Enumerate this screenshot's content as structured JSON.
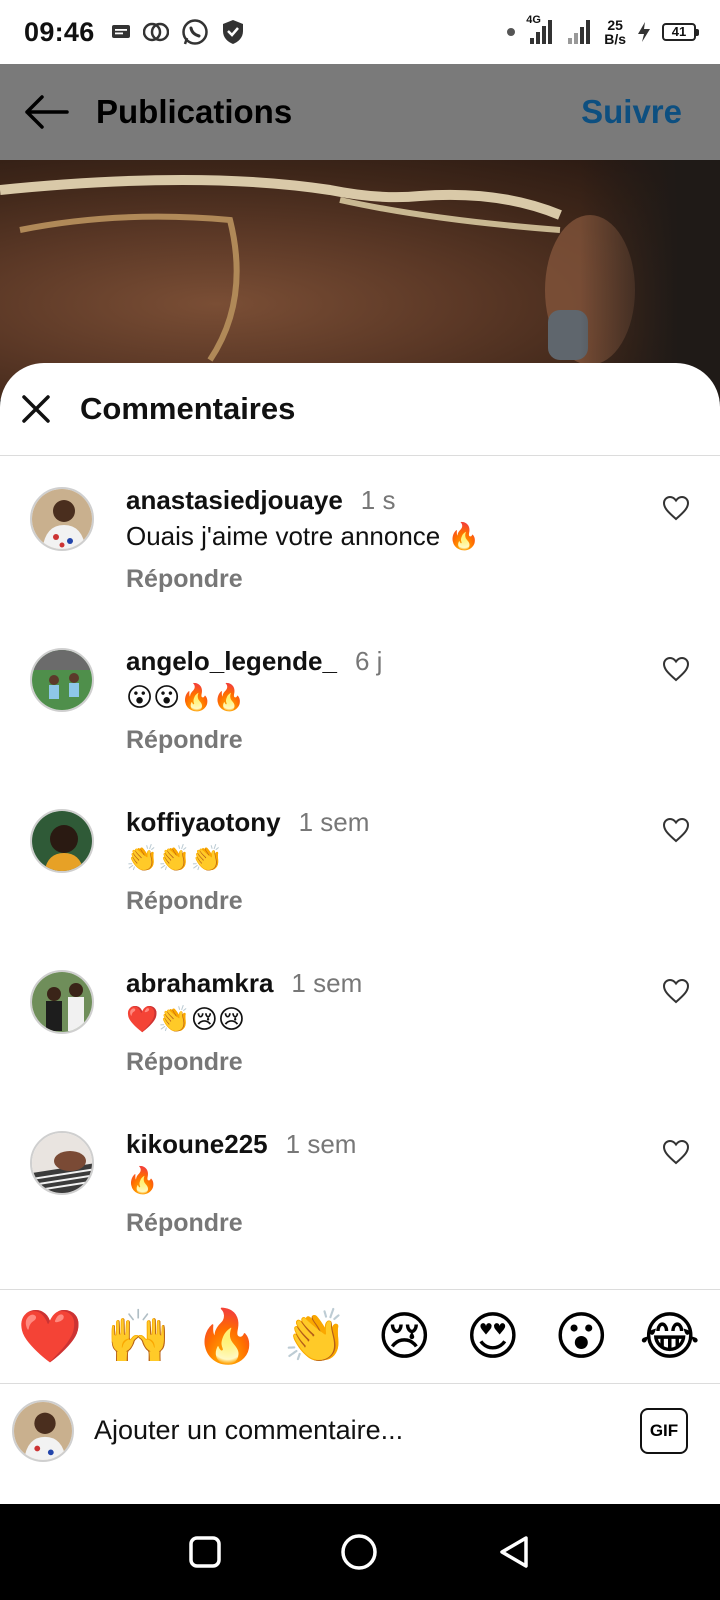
{
  "status_bar": {
    "time": "09:46",
    "network_type": "4G",
    "net_speed_value": "25",
    "net_speed_unit": "B/s",
    "battery": "41"
  },
  "header": {
    "title": "Publications",
    "follow_label": "Suivre"
  },
  "comments_sheet": {
    "title": "Commentaires",
    "reply_label": "Répondre",
    "items": [
      {
        "username": "anastasiedjouaye",
        "time": "1 s",
        "text": "Ouais j'aime votre annonce 🔥"
      },
      {
        "username": "angelo_legende_",
        "time": "6 j",
        "text": "😮😮🔥🔥"
      },
      {
        "username": "koffiyaotony",
        "time": "1 sem",
        "text": "👏👏👏"
      },
      {
        "username": "abrahamkra",
        "time": "1 sem",
        "text": "❤️👏😢😢"
      },
      {
        "username": "kikoune225",
        "time": "1 sem",
        "text": "🔥"
      }
    ]
  },
  "reactions": [
    "❤️",
    "🙌",
    "🔥",
    "👏",
    "😢",
    "😍",
    "😮",
    "😂"
  ],
  "composer": {
    "placeholder": "Ajouter un commentaire...",
    "gif_label": "GIF"
  },
  "colors": {
    "follow_accent": "#0d4f80",
    "header_bg": "#7a7a7a",
    "muted_text": "#777777"
  }
}
